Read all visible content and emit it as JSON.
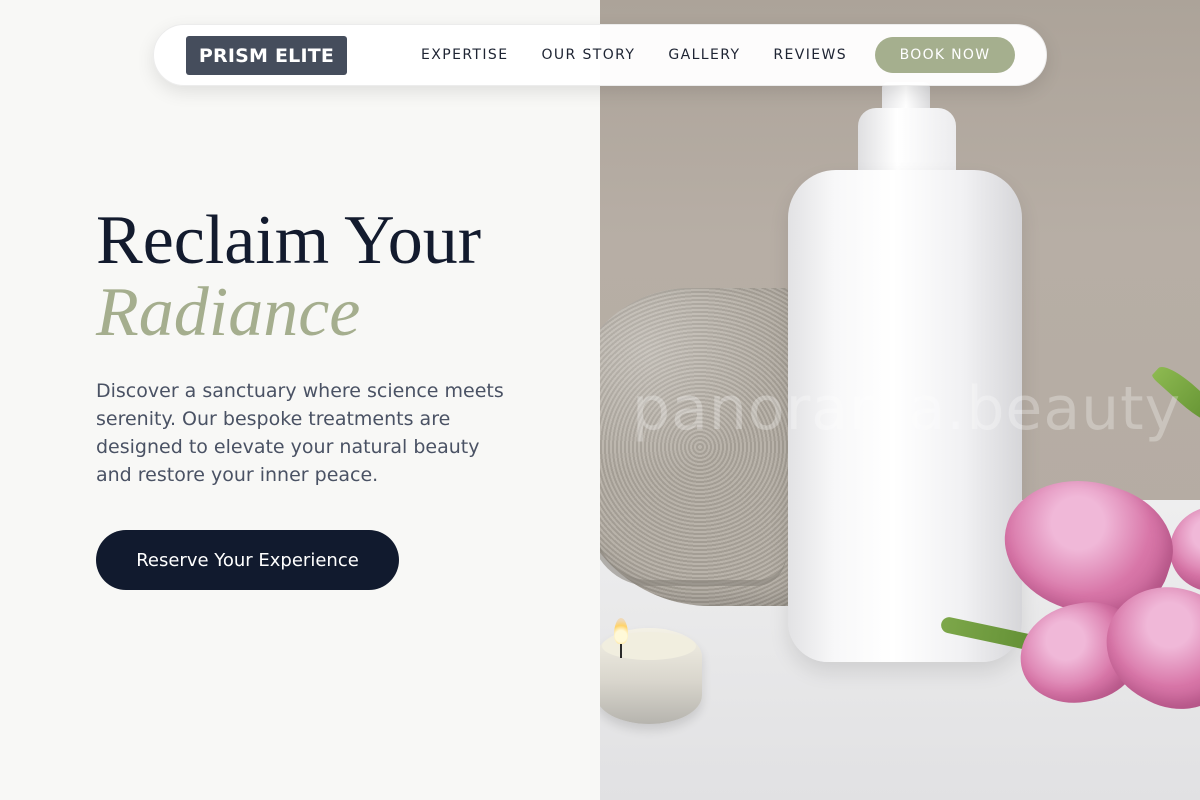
{
  "brand": {
    "logo_text": "PRISM ELITE"
  },
  "nav": {
    "links": [
      {
        "label": "EXPERTISE"
      },
      {
        "label": "OUR STORY"
      },
      {
        "label": "GALLERY"
      },
      {
        "label": "REVIEWS"
      }
    ],
    "book_label": "BOOK NOW"
  },
  "hero": {
    "headline_line1": "Reclaim Your",
    "headline_line2": "Radiance",
    "description": "Discover a sanctuary where science meets serenity. Our bespoke treatments are designed to elevate your natural beauty and restore your inner peace.",
    "cta_label": "Reserve Your Experience"
  },
  "hero_image": {
    "watermark": "panorama.beauty"
  },
  "colors": {
    "accent_sage": "#a5af8e",
    "navy": "#111a2e",
    "logo_bg": "#454d5c",
    "background": "#f8f8f6"
  },
  "icons": {
    "hero_image_subject": "spa-bottle-towel-candle-tulips-photo"
  }
}
